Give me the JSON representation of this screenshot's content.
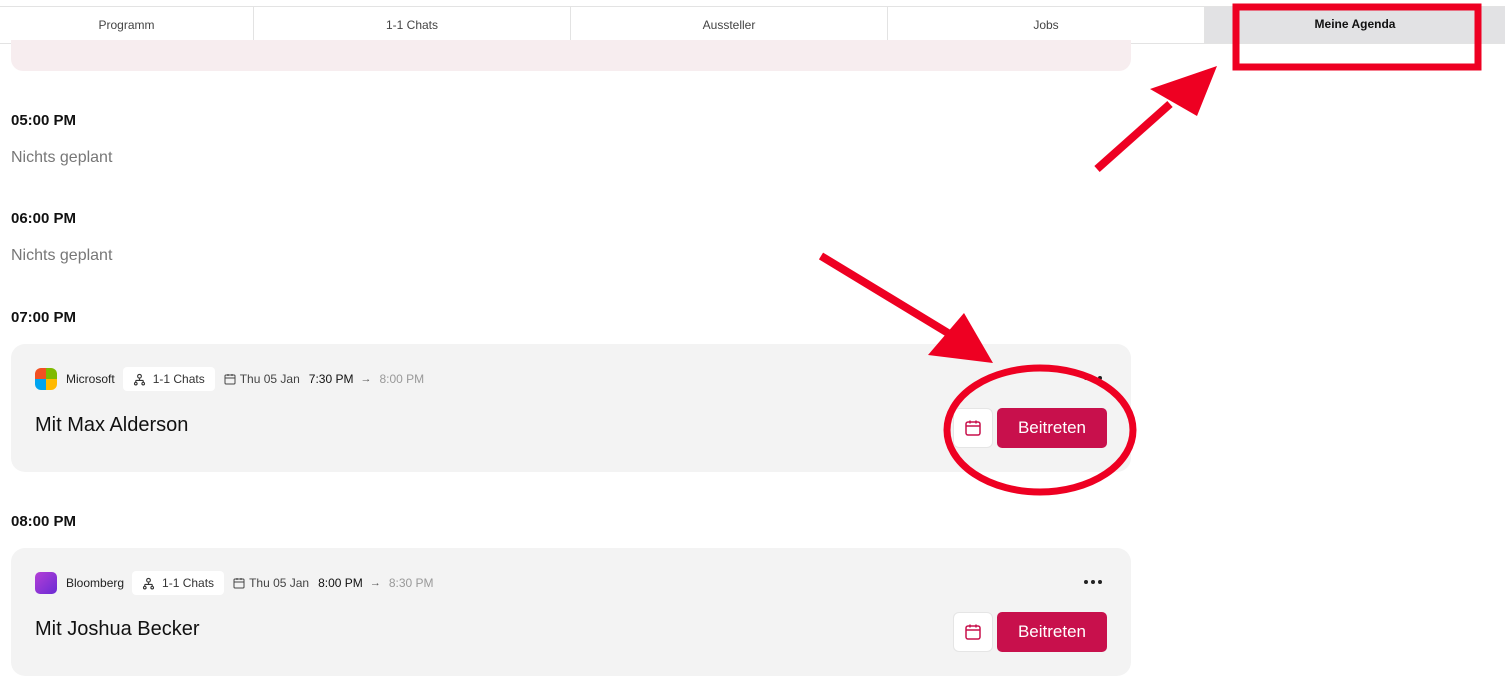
{
  "tabs": [
    {
      "label": "Programm"
    },
    {
      "label": "1-1 Chats"
    },
    {
      "label": "Aussteller"
    },
    {
      "label": "Jobs"
    },
    {
      "label": "Meine Agenda"
    }
  ],
  "slots": [
    {
      "time": "05:00 PM",
      "empty_text": "Nichts geplant"
    },
    {
      "time": "06:00 PM",
      "empty_text": "Nichts geplant"
    },
    {
      "time": "07:00 PM"
    },
    {
      "time": "08:00 PM"
    }
  ],
  "meetings": [
    {
      "company": "Microsoft",
      "company_logo": "microsoft-logo",
      "type_label": "1-1 Chats",
      "date": "Thu 05 Jan",
      "start": "7:30 PM",
      "end": "8:00 PM",
      "title": "Mit Max Alderson",
      "join_label": "Beitreten"
    },
    {
      "company": "Bloomberg",
      "company_logo": "bloomberg-logo",
      "type_label": "1-1 Chats",
      "date": "Thu 05 Jan",
      "start": "8:00 PM",
      "end": "8:30 PM",
      "title": "Mit Joshua Becker",
      "join_label": "Beitreten"
    }
  ],
  "colors": {
    "accent": "#c8104c",
    "annotation": "#ee0022",
    "active_tab_bg": "#e2e2e4"
  }
}
